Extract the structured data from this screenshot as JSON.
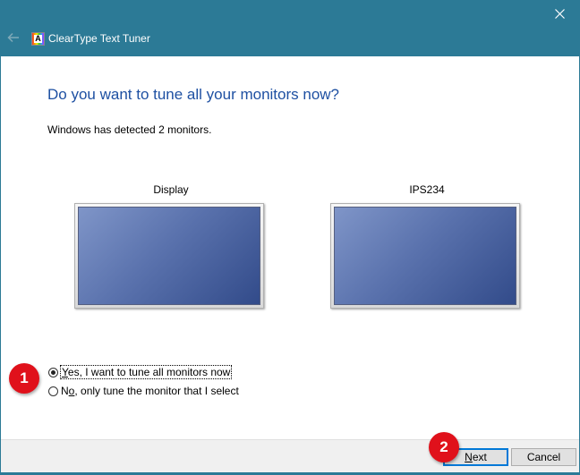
{
  "window": {
    "title": "ClearType Text Tuner",
    "back_icon": "back-arrow-icon",
    "app_icon": "cleartype-icon",
    "app_icon_glyph": "A",
    "close_icon": "close-icon"
  },
  "main": {
    "heading": "Do you want to tune all your monitors now?",
    "subtext": "Windows has detected 2 monitors.",
    "monitors": [
      {
        "label": "Display"
      },
      {
        "label": "IPS234"
      }
    ],
    "options": [
      {
        "mnemonic": "Y",
        "rest": "es, I want to tune all monitors now",
        "checked": true
      },
      {
        "prefix": "N",
        "mnemonic": "o",
        "rest": ", only tune the monitor that I select",
        "checked": false
      }
    ]
  },
  "annotations": [
    {
      "number": "1"
    },
    {
      "number": "2"
    }
  ],
  "footer": {
    "next_mnemonic": "N",
    "next_rest": "ext",
    "cancel_label": "Cancel"
  },
  "colors": {
    "titlebar": "#2c7a96",
    "heading": "#1e50a2",
    "badge": "#e0111b",
    "default_button_border": "#0078d7"
  }
}
